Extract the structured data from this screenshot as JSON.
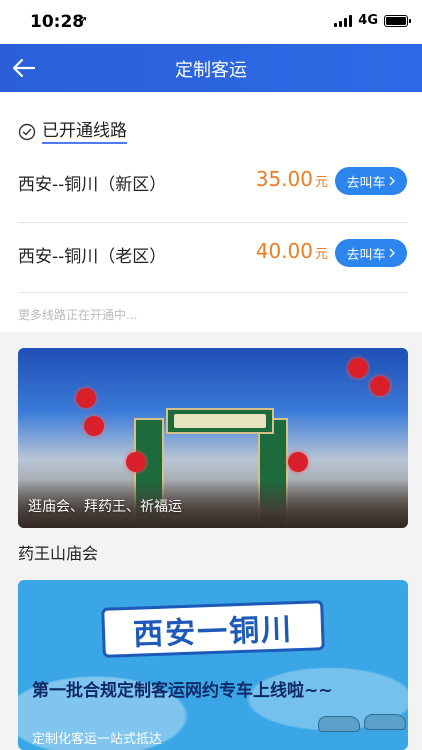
{
  "status": {
    "time": "10:28",
    "location_arrow": "➚",
    "network": "4G"
  },
  "nav": {
    "title": "定制客运"
  },
  "routes": {
    "header": "已开通线路",
    "items": [
      {
        "name": "西安--铜川（新区）",
        "price": "35.00",
        "unit": "元",
        "button": "去叫车"
      },
      {
        "name": "西安--铜川（老区）",
        "price": "40.00",
        "unit": "元",
        "button": "去叫车"
      }
    ],
    "more": "更多线路正在开通中..."
  },
  "promos": [
    {
      "caption": "逛庙会、拜药王、祈福运",
      "title": "药王山庙会"
    },
    {
      "headline": "西安一铜川",
      "subheadline": "第一批合规定制客运网约专车上线啦~~",
      "footer": "定制化客运一站式抵达"
    }
  ]
}
